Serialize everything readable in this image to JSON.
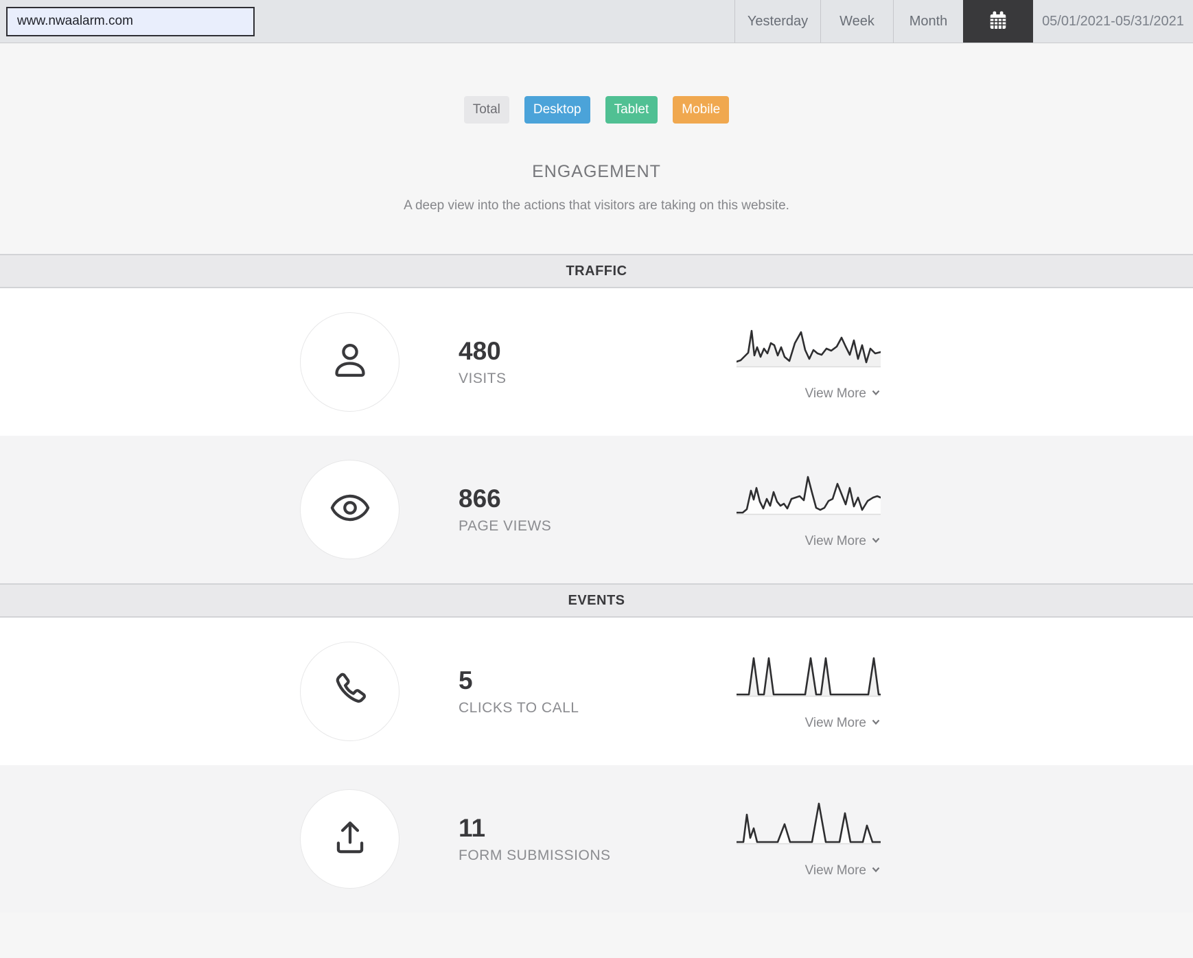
{
  "toolbar": {
    "url_value": "www.nwaalarm.com",
    "tabs": [
      {
        "label": "Yesterday"
      },
      {
        "label": "Week"
      },
      {
        "label": "Month"
      }
    ],
    "date_range": "05/01/2021-05/31/2021",
    "calendar_button_color": "#39393b"
  },
  "filters": [
    {
      "label": "Total",
      "bg": "#e7e7e9",
      "fg": "#6e6e73"
    },
    {
      "label": "Desktop",
      "bg": "#4ba3d9",
      "fg": "#ffffff"
    },
    {
      "label": "Tablet",
      "bg": "#50c093",
      "fg": "#ffffff"
    },
    {
      "label": "Mobile",
      "bg": "#f0a84f",
      "fg": "#ffffff"
    }
  ],
  "engagement": {
    "title": "ENGAGEMENT",
    "subtitle": "A deep view into the actions that visitors are taking on this website."
  },
  "sections": [
    {
      "header": "TRAFFIC",
      "rows": [
        {
          "icon": "user-icon",
          "value": "480",
          "label": "VISITS",
          "view_more": "View More",
          "spark_fill": "#f1f1f1",
          "spark": [
            [
              0,
              57
            ],
            [
              6,
              55
            ],
            [
              12,
              49
            ],
            [
              17,
              44
            ],
            [
              22,
              12
            ],
            [
              26,
              48
            ],
            [
              30,
              36
            ],
            [
              35,
              50
            ],
            [
              40,
              38
            ],
            [
              45,
              45
            ],
            [
              50,
              30
            ],
            [
              55,
              33
            ],
            [
              60,
              48
            ],
            [
              65,
              36
            ],
            [
              70,
              50
            ],
            [
              77,
              56
            ],
            [
              85,
              30
            ],
            [
              94,
              14
            ],
            [
              100,
              40
            ],
            [
              106,
              53
            ],
            [
              112,
              40
            ],
            [
              118,
              45
            ],
            [
              124,
              47
            ],
            [
              131,
              38
            ],
            [
              138,
              41
            ],
            [
              146,
              35
            ],
            [
              153,
              22
            ],
            [
              159,
              35
            ],
            [
              165,
              47
            ],
            [
              171,
              26
            ],
            [
              177,
              53
            ],
            [
              183,
              33
            ],
            [
              189,
              58
            ],
            [
              195,
              38
            ],
            [
              202,
              45
            ],
            [
              210,
              43
            ]
          ]
        },
        {
          "icon": "eye-icon",
          "value": "866",
          "label": "PAGE VIEWS",
          "view_more": "View More",
          "spark_fill": "#fdfdfd",
          "spark": [
            [
              0,
              62
            ],
            [
              9,
              62
            ],
            [
              15,
              57
            ],
            [
              21,
              30
            ],
            [
              25,
              43
            ],
            [
              29,
              26
            ],
            [
              34,
              46
            ],
            [
              39,
              56
            ],
            [
              44,
              42
            ],
            [
              49,
              52
            ],
            [
              54,
              32
            ],
            [
              59,
              46
            ],
            [
              64,
              52
            ],
            [
              69,
              49
            ],
            [
              74,
              56
            ],
            [
              80,
              42
            ],
            [
              86,
              40
            ],
            [
              92,
              38
            ],
            [
              98,
              44
            ],
            [
              104,
              10
            ],
            [
              110,
              33
            ],
            [
              116,
              55
            ],
            [
              122,
              58
            ],
            [
              128,
              55
            ],
            [
              134,
              45
            ],
            [
              140,
              42
            ],
            [
              147,
              20
            ],
            [
              153,
              35
            ],
            [
              159,
              50
            ],
            [
              165,
              26
            ],
            [
              171,
              53
            ],
            [
              177,
              40
            ],
            [
              183,
              58
            ],
            [
              191,
              45
            ],
            [
              199,
              40
            ],
            [
              205,
              38
            ],
            [
              210,
              40
            ]
          ]
        }
      ]
    },
    {
      "header": "EVENTS",
      "rows": [
        {
          "icon": "phone-icon",
          "value": "5",
          "label": "CLICKS TO CALL",
          "view_more": "View More",
          "spark_fill": "#f1f1f1",
          "spark": [
            [
              0,
              62
            ],
            [
              18,
              62
            ],
            [
              25,
              9
            ],
            [
              32,
              62
            ],
            [
              40,
              62
            ],
            [
              47,
              9
            ],
            [
              54,
              62
            ],
            [
              100,
              62
            ],
            [
              108,
              9
            ],
            [
              116,
              62
            ],
            [
              123,
              62
            ],
            [
              130,
              9
            ],
            [
              137,
              62
            ],
            [
              192,
              62
            ],
            [
              200,
              9
            ],
            [
              207,
              62
            ],
            [
              210,
              62
            ]
          ]
        },
        {
          "icon": "upload-icon",
          "value": "11",
          "label": "FORM SUBMISSIONS",
          "view_more": "View More",
          "spark_fill": "#fdfdfd",
          "spark": [
            [
              0,
              62
            ],
            [
              10,
              62
            ],
            [
              15,
              22
            ],
            [
              20,
              56
            ],
            [
              25,
              42
            ],
            [
              30,
              62
            ],
            [
              60,
              62
            ],
            [
              70,
              36
            ],
            [
              78,
              62
            ],
            [
              110,
              62
            ],
            [
              120,
              6
            ],
            [
              130,
              62
            ],
            [
              150,
              62
            ],
            [
              158,
              20
            ],
            [
              166,
              62
            ],
            [
              184,
              62
            ],
            [
              190,
              38
            ],
            [
              198,
              62
            ],
            [
              210,
              62
            ]
          ]
        }
      ]
    }
  ]
}
